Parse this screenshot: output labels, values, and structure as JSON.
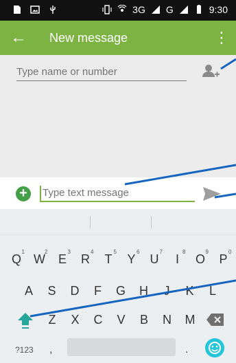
{
  "statusbar": {
    "network": "3G",
    "carrier2": "G",
    "time": "9:30"
  },
  "appbar": {
    "title": "New message"
  },
  "to_field": {
    "placeholder": "Type name or number"
  },
  "compose": {
    "placeholder": "Type text message"
  },
  "keyboard": {
    "row1": [
      {
        "k": "Q",
        "n": "1"
      },
      {
        "k": "W",
        "n": "2"
      },
      {
        "k": "E",
        "n": "3"
      },
      {
        "k": "R",
        "n": "4"
      },
      {
        "k": "T",
        "n": "5"
      },
      {
        "k": "Y",
        "n": "6"
      },
      {
        "k": "U",
        "n": "7"
      },
      {
        "k": "I",
        "n": "8"
      },
      {
        "k": "O",
        "n": "9"
      },
      {
        "k": "P",
        "n": "0"
      }
    ],
    "row2": [
      "A",
      "S",
      "D",
      "F",
      "G",
      "H",
      "J",
      "K",
      "L"
    ],
    "row3": [
      "Z",
      "X",
      "C",
      "V",
      "B",
      "N",
      "M"
    ],
    "sym_label": "?123",
    "comma": ",",
    "period": "."
  },
  "colors": {
    "appbar": "#7cb342",
    "accent": "#43a047",
    "callout": "#1565c0"
  }
}
